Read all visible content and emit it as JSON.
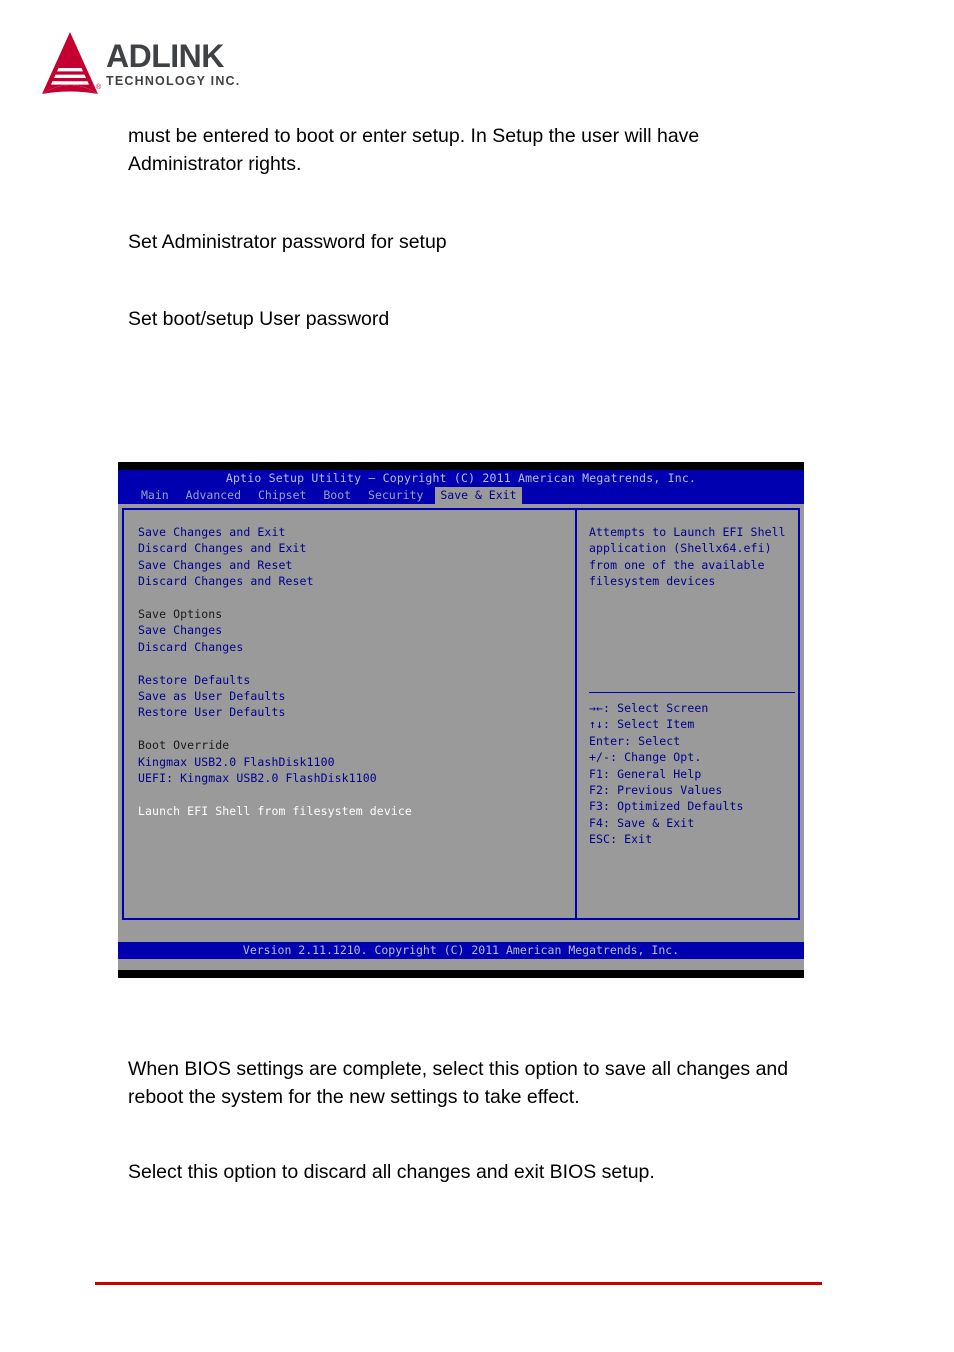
{
  "logo": {
    "mark": "adlink-triangle-logo",
    "word": "ADLINK",
    "sub": "TECHNOLOGY INC.",
    "registered": "®",
    "red": "#c3002f",
    "gray": "#3f4245"
  },
  "document": {
    "paragraphs": {
      "p1": "must be entered to boot or enter setup. In Setup the user will have Administrator rights.",
      "p2": "Set Administrator password for setup",
      "p3": "Set boot/setup User password",
      "p4": "When BIOS settings are complete, select this option to save all changes and reboot the system for the new settings to take effect.",
      "p5": "Select this option to discard all changes and exit BIOS setup."
    },
    "rule_color": "#cc0000"
  },
  "bios": {
    "title": "Aptio Setup Utility – Copyright (C) 2011 American Megatrends, Inc.",
    "footer": "Version 2.11.1210. Copyright (C) 2011 American Megatrends, Inc.",
    "colors": {
      "background": "#9a9a9a",
      "bar": "#0000b0",
      "text": "#00008b",
      "bar_text": "#b8bfd8",
      "selected_text": "#ffffff",
      "header_text": "#1a1a1a"
    },
    "tabs": [
      {
        "label": "Main",
        "active": false
      },
      {
        "label": "Advanced",
        "active": false
      },
      {
        "label": "Chipset",
        "active": false
      },
      {
        "label": "Boot",
        "active": false
      },
      {
        "label": "Security",
        "active": false
      },
      {
        "label": "Save & Exit",
        "active": true
      }
    ],
    "menu_items": [
      {
        "label": "Save Changes and Exit",
        "style": "item"
      },
      {
        "label": "Discard Changes and Exit",
        "style": "item"
      },
      {
        "label": "Save Changes and Reset",
        "style": "item"
      },
      {
        "label": "Discard Changes and Reset",
        "style": "item"
      },
      {
        "label": "",
        "style": "blank"
      },
      {
        "label": "Save Options",
        "style": "header"
      },
      {
        "label": "Save Changes",
        "style": "item"
      },
      {
        "label": "Discard Changes",
        "style": "item"
      },
      {
        "label": "",
        "style": "blank"
      },
      {
        "label": "Restore Defaults",
        "style": "item"
      },
      {
        "label": "Save as User Defaults",
        "style": "item"
      },
      {
        "label": "Restore User Defaults",
        "style": "item"
      },
      {
        "label": "",
        "style": "blank"
      },
      {
        "label": "Boot Override",
        "style": "header"
      },
      {
        "label": "Kingmax USB2.0 FlashDisk1100",
        "style": "item"
      },
      {
        "label": "UEFI: Kingmax USB2.0 FlashDisk1100",
        "style": "item"
      },
      {
        "label": "",
        "style": "blank"
      },
      {
        "label": "Launch EFI Shell from filesystem device",
        "style": "selected"
      }
    ],
    "help_text": [
      "Attempts to Launch EFI Shell",
      "application (Shellx64.efi)",
      "from one of the available",
      "filesystem devices"
    ],
    "key_legend": [
      "→←: Select Screen",
      "↑↓: Select Item",
      "Enter: Select",
      "+/-: Change Opt.",
      "F1: General Help",
      "F2: Previous Values",
      "F3: Optimized Defaults",
      "F4: Save & Exit",
      "ESC: Exit"
    ]
  }
}
